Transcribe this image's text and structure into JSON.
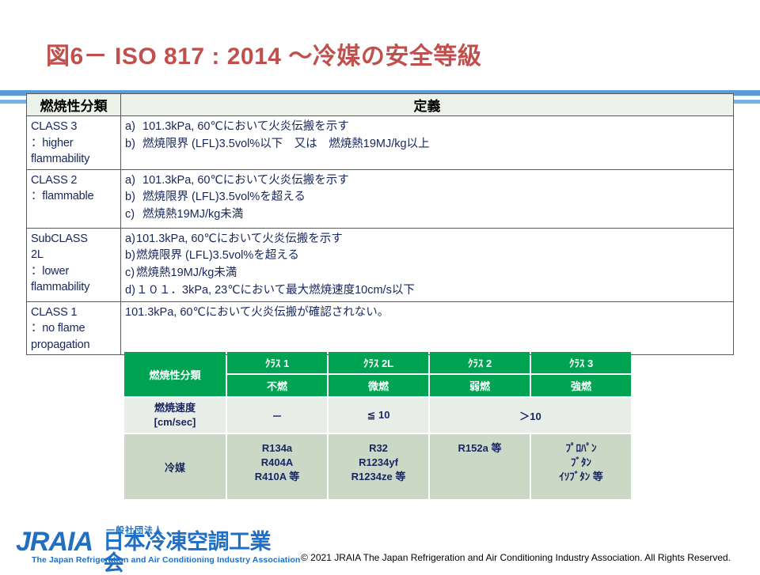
{
  "slide": {
    "title": "図6－ ISO 817 : 2014 ～冷媒の安全等級",
    "title_color": "#c0504d"
  },
  "definition_table": {
    "headers": [
      "燃焼性分類",
      "定義"
    ],
    "rows": [
      {
        "class_lines": [
          "CLASS  3",
          "：higher",
          "flammability"
        ],
        "definition_lines": [
          {
            "marker": "a)",
            "text": "101.3kPa, 60℃において火炎伝搬を示す"
          },
          {
            "marker": "b)",
            "text": "燃焼限界 (LFL)3.5vol%以下　又は　燃焼熱19MJ/kg以上"
          }
        ]
      },
      {
        "class_lines": [
          "CLASS  2",
          "：flammable"
        ],
        "definition_lines": [
          {
            "marker": "a)",
            "text": "101.3kPa, 60℃において火炎伝搬を示す"
          },
          {
            "marker": "b)",
            "text": "燃焼限界 (LFL)3.5vol%を超える"
          },
          {
            "marker": "c)",
            "text": "燃焼熱19MJ/kg未満"
          }
        ]
      },
      {
        "class_lines": [
          "SubCLASS",
          "2L",
          "：lower",
          "flammability"
        ],
        "definition_lines": [
          {
            "marker": "a)",
            "text": "101.3kPa, 60℃において火炎伝搬を示す"
          },
          {
            "marker": "b)",
            "text": "燃焼限界 (LFL)3.5vol%を超える"
          },
          {
            "marker": "c)",
            "text": "燃焼熱19MJ/kg未満"
          },
          {
            "marker": "d)",
            "text": "１０１．3kPa, 23℃において最大燃焼速度10cm/s以下"
          }
        ]
      },
      {
        "class_lines": [
          "CLASS  1",
          "：no flame",
          "propagation"
        ],
        "definition_lines": [
          {
            "marker": "",
            "text": "101.3kPa, 60℃において火炎伝搬が確認されない。"
          }
        ]
      }
    ]
  },
  "class_table": {
    "colors": {
      "green": "#00a352",
      "pale": "#e9ede8",
      "sage": "#ccd8c6"
    },
    "row_label_1": "燃焼性分類",
    "class_names": [
      "ｸﾗｽ 1",
      "ｸﾗｽ 2L",
      "ｸﾗｽ 2",
      "ｸﾗｽ 3"
    ],
    "burn_names": [
      "不燃",
      "微燃",
      "弱燃",
      "強燃"
    ],
    "row_label_2_line1": "燃焼速度",
    "row_label_2_line2": "[cm/sec]",
    "speed_values": [
      "－",
      "≦ 10",
      "＞10"
    ],
    "row_label_3": "冷媒",
    "refrigerants": [
      [
        "R134a",
        "R404A",
        "R410A  等"
      ],
      [
        "R32",
        "R1234yf",
        "R1234ze  等"
      ],
      [
        "R152a  等"
      ],
      [
        "ﾌﾟﾛﾊﾟﾝ",
        "ﾌﾞﾀﾝ",
        "ｲｿﾌﾞﾀﾝ  等"
      ]
    ]
  },
  "footer": {
    "logo_wordmark": "JRAIA",
    "logo_corp_jp": "一般社団法人",
    "logo_name_jp": "日本冷凍空調工業会",
    "logo_name_en": "The Japan Refrigeration and Air Conditioning Industry Association",
    "copyright": "© 2021 JRAIA The Japan Refrigeration and Air Conditioning Industry Association.  All Rights Reserved."
  }
}
